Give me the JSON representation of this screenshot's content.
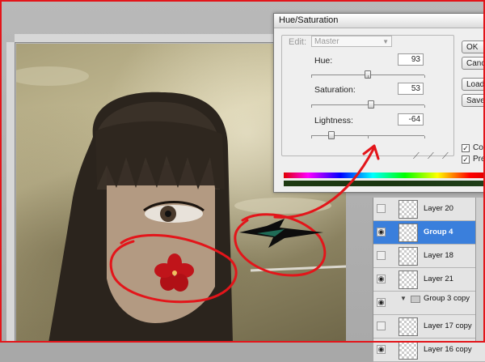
{
  "dialog": {
    "title": "Hue/Saturation",
    "edit_label": "Edit:",
    "edit_value": "Master",
    "hue": {
      "label": "Hue:",
      "value": "93",
      "position": 0.5
    },
    "saturation": {
      "label": "Saturation:",
      "value": "53",
      "position": 0.53
    },
    "lightness": {
      "label": "Lightness:",
      "value": "-64",
      "position": 0.18
    },
    "buttons": {
      "ok": "OK",
      "cancel": "Cancel",
      "load": "Load...",
      "save": "Save..."
    },
    "colorize_label": "Colorize",
    "preview_label": "Preview"
  },
  "layers": [
    {
      "name": "Layer 20",
      "selected": false,
      "visible": false,
      "kind": "layer"
    },
    {
      "name": "Group 4",
      "selected": true,
      "visible": true,
      "kind": "layer"
    },
    {
      "name": "Layer 18",
      "selected": false,
      "visible": false,
      "kind": "layer"
    },
    {
      "name": "Layer 21",
      "selected": false,
      "visible": true,
      "kind": "layer"
    },
    {
      "name": "Group 3 copy",
      "selected": false,
      "visible": true,
      "kind": "group"
    },
    {
      "name": "Layer 17 copy",
      "selected": false,
      "visible": false,
      "kind": "layer"
    },
    {
      "name": "Layer 16 copy",
      "selected": false,
      "visible": true,
      "kind": "layer"
    }
  ],
  "colors": {
    "annotation": "#e3151a",
    "selection": "#3a7fdc"
  }
}
